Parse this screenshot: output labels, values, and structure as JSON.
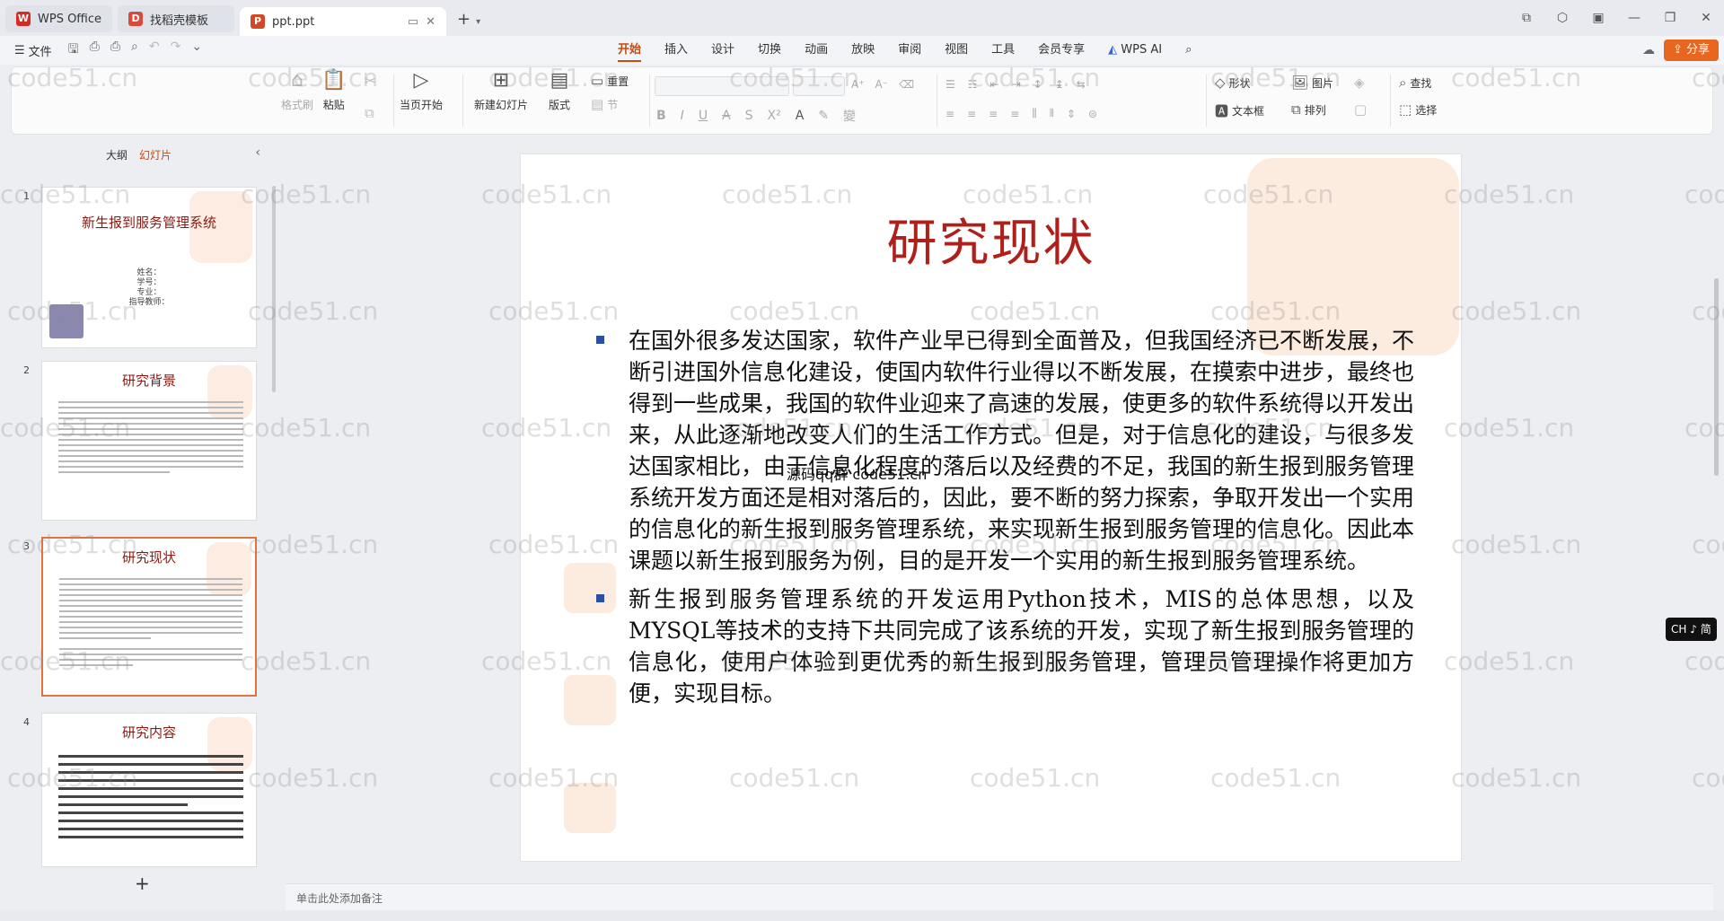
{
  "tabs": [
    {
      "label": "WPS Office",
      "icon": "wps-logo-icon"
    },
    {
      "label": "找稻壳模板",
      "icon": "docer-icon"
    },
    {
      "label": "ppt.ppt",
      "icon": "ppt-file-icon"
    }
  ],
  "menu": {
    "file": "文件",
    "tabs": [
      "开始",
      "插入",
      "设计",
      "切换",
      "动画",
      "放映",
      "审阅",
      "视图",
      "工具",
      "会员专享"
    ],
    "active_tab": "开始",
    "wps_ai": "WPS AI",
    "share": "分享"
  },
  "ribbon": {
    "format_painter": "格式刷",
    "paste": "粘贴",
    "start_from_current": "当页开始",
    "new_slide": "新建幻灯片",
    "layout": "版式",
    "reset": "重置",
    "section": "节",
    "shape": "形状",
    "picture": "图片",
    "textbox": "文本框",
    "arrange": "排列",
    "find": "查找",
    "select": "选择"
  },
  "left_panel": {
    "outline_tab": "大纲",
    "slides_tab": "幻灯片",
    "thumbnails": [
      {
        "num": "1",
        "title": "新生报到服务管理系统",
        "info": [
          "姓名：",
          "学号：",
          "专业：",
          "指导教师："
        ]
      },
      {
        "num": "2",
        "title": "研究背景"
      },
      {
        "num": "3",
        "title": "研究现状"
      },
      {
        "num": "4",
        "title": "研究内容"
      }
    ],
    "add_button": "+"
  },
  "slide": {
    "title": "研究现状",
    "bullets": [
      "在国外很多发达国家，软件产业早已得到全面普及，但我国经济已不断发展，不断引进国外信息化建设，使国内软件行业得以不断发展，在摸索中进步，最终也得到一些成果，我国的软件业迎来了高速的发展，使更多的软件系统得以开发出来，从此逐渐地改变人们的生活工作方式。但是，对于信息化的建设，与很多发达国家相比，由于信息化程度的落后以及经费的不足，我国的新生报到服务管理系统开发方面还是相对落后的，因此，要不断的努力探索，争取开发出一个实用的信息化的新生报到服务管理系统，来实现新生报到服务管理的信息化。因此本课题以新生报到服务为例，目的是开发一个实用的新生报到服务管理系统。",
      "新生报到服务管理系统的开发运用Python技术，MIS的总体思想，以及MYSQL等技术的支持下共同完成了该系统的开发，实现了新生报到服务管理的信息化，使用户体验到更优秀的新生报到服务管理，管理员管理操作将更加方便，实现目标。"
    ],
    "overlay": "源码qq群 code51.cn"
  },
  "notes_placeholder": "单击此处添加备注",
  "ime": "CH ♪ 简",
  "watermark": "code51.cn",
  "colors": {
    "accent": "#c84a0c",
    "title_red": "#b0201a",
    "bullet_blue": "#2b4fa3",
    "share": "#e8661f"
  }
}
